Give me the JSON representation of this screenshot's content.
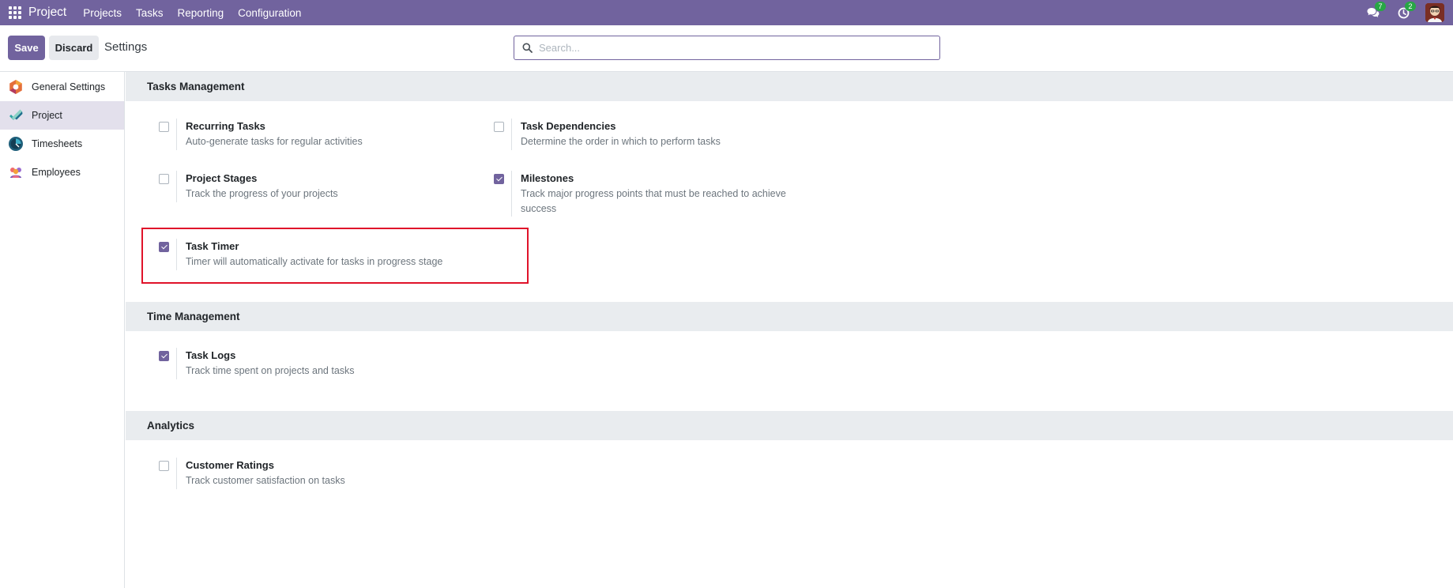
{
  "navbar": {
    "brand": "Project",
    "menu": [
      "Projects",
      "Tasks",
      "Reporting",
      "Configuration"
    ],
    "messages_count": "7",
    "activities_count": "2"
  },
  "control_panel": {
    "save_label": "Save",
    "discard_label": "Discard",
    "title": "Settings",
    "search_placeholder": "Search..."
  },
  "sidebar": {
    "items": [
      {
        "label": "General Settings",
        "icon": "general-settings-icon",
        "active": false
      },
      {
        "label": "Project",
        "icon": "project-app-icon",
        "active": true
      },
      {
        "label": "Timesheets",
        "icon": "timesheets-app-icon",
        "active": false
      },
      {
        "label": "Employees",
        "icon": "employees-app-icon",
        "active": false
      }
    ]
  },
  "sections": {
    "tasks_management": {
      "title": "Tasks Management",
      "settings": {
        "recurring_tasks": {
          "title": "Recurring Tasks",
          "desc": "Auto-generate tasks for regular activities",
          "checked": false
        },
        "task_dependencies": {
          "title": "Task Dependencies",
          "desc": "Determine the order in which to perform tasks",
          "checked": false
        },
        "project_stages": {
          "title": "Project Stages",
          "desc": "Track the progress of your projects",
          "checked": false
        },
        "milestones": {
          "title": "Milestones",
          "desc": "Track major progress points that must be reached to achieve success",
          "checked": true
        },
        "task_timer": {
          "title": "Task Timer",
          "desc": "Timer will automatically activate for tasks in progress stage",
          "checked": true
        }
      }
    },
    "time_management": {
      "title": "Time Management",
      "settings": {
        "task_logs": {
          "title": "Task Logs",
          "desc": "Track time spent on projects and tasks",
          "checked": true
        }
      }
    },
    "analytics": {
      "title": "Analytics",
      "settings": {
        "customer_ratings": {
          "title": "Customer Ratings",
          "desc": "Track customer satisfaction on tasks",
          "checked": false
        }
      }
    }
  },
  "colors": {
    "brand": "#71639e",
    "highlight": "#e0132a",
    "badge": "#28a745"
  }
}
